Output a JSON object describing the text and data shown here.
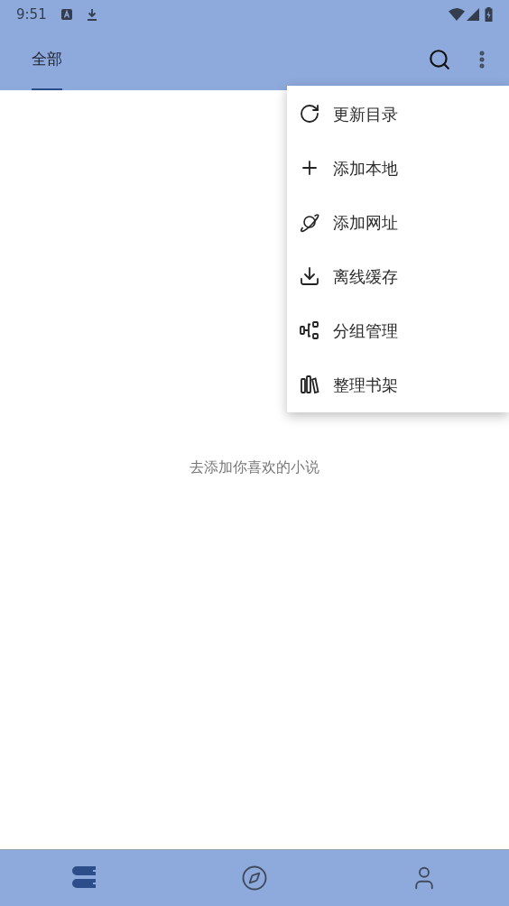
{
  "status_bar": {
    "time": "9:51"
  },
  "tabs": [
    {
      "label": "全部",
      "selected": true
    }
  ],
  "menu": {
    "items": [
      {
        "kind": "refresh",
        "label": "更新目录"
      },
      {
        "kind": "add",
        "label": "添加本地"
      },
      {
        "kind": "planet",
        "label": "添加网址"
      },
      {
        "kind": "download",
        "label": "离线缓存"
      },
      {
        "kind": "group",
        "label": "分组管理"
      },
      {
        "kind": "shelf",
        "label": "整理书架"
      }
    ]
  },
  "empty_message": "去添加你喜欢的小说",
  "bottom_nav": [
    {
      "kind": "bookshelf",
      "selected": true
    },
    {
      "kind": "explore",
      "selected": false
    },
    {
      "kind": "profile",
      "selected": false
    }
  ]
}
